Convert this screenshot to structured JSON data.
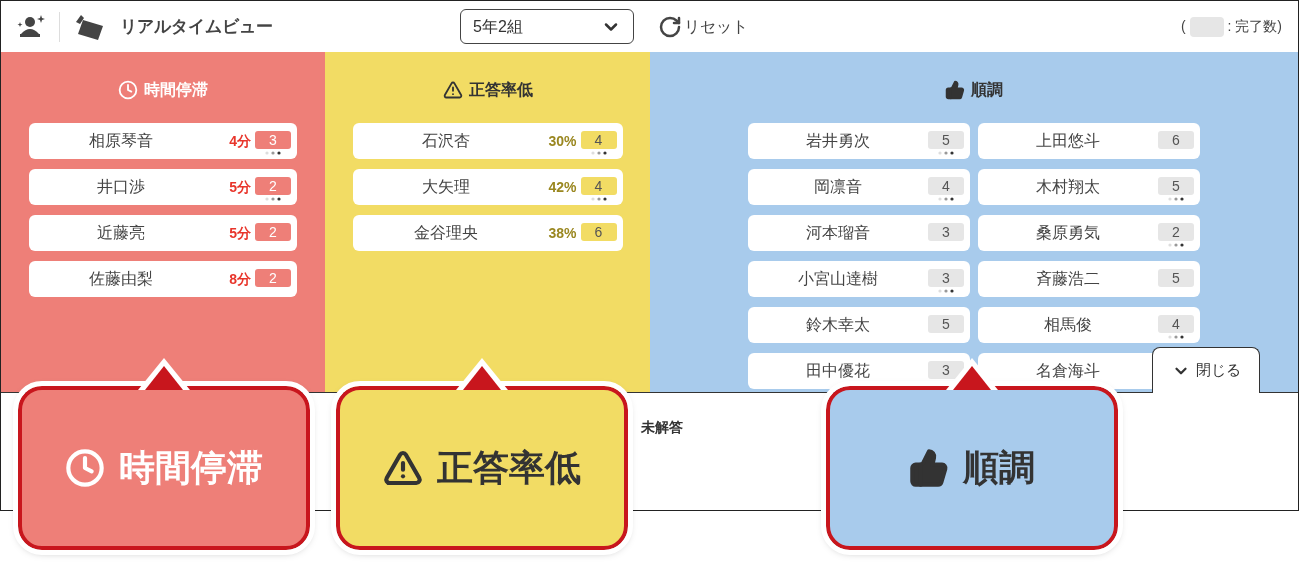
{
  "header": {
    "title": "リアルタイムビュー",
    "class_select": "5年2組",
    "reset": "リセット",
    "legend_open": "(",
    "legend_label": ": 完了数)"
  },
  "columns": [
    {
      "kind": "stalled",
      "title": "時間停滞",
      "students": [
        {
          "name": "相原琴音",
          "metric": "4分",
          "count": "3",
          "dots": true
        },
        {
          "name": "井口渉",
          "metric": "5分",
          "count": "2",
          "dots": true
        },
        {
          "name": "近藤亮",
          "metric": "5分",
          "count": "2",
          "dots": false
        },
        {
          "name": "佐藤由梨",
          "metric": "8分",
          "count": "2",
          "dots": false
        }
      ]
    },
    {
      "kind": "low_accuracy",
      "title": "正答率低",
      "students": [
        {
          "name": "石沢杏",
          "metric": "30%",
          "count": "4",
          "dots": true
        },
        {
          "name": "大矢理",
          "metric": "42%",
          "count": "4",
          "dots": true
        },
        {
          "name": "金谷理央",
          "metric": "38%",
          "count": "6",
          "dots": false
        }
      ]
    },
    {
      "kind": "on_track",
      "title": "順調",
      "students": [
        {
          "name": "岩井勇次",
          "count": "5",
          "dots": true
        },
        {
          "name": "上田悠斗",
          "count": "6",
          "dots": false
        },
        {
          "name": "岡凛音",
          "count": "4",
          "dots": true
        },
        {
          "name": "木村翔太",
          "count": "5",
          "dots": true
        },
        {
          "name": "河本瑠音",
          "count": "3",
          "dots": false
        },
        {
          "name": "桑原勇気",
          "count": "2",
          "dots": true
        },
        {
          "name": "小宮山達樹",
          "count": "3",
          "dots": true
        },
        {
          "name": "斉藤浩二",
          "count": "5",
          "dots": false
        },
        {
          "name": "鈴木幸太",
          "count": "5",
          "dots": false
        },
        {
          "name": "相馬俊",
          "count": "4",
          "dots": true
        },
        {
          "name": "田中優花",
          "count": "3"
        },
        {
          "name": "名倉海斗"
        }
      ]
    }
  ],
  "close_tab": "閉じる",
  "unanswered_label": "未解答",
  "callouts": [
    {
      "kind": "stalled",
      "label": "時間停滞"
    },
    {
      "kind": "low_accuracy",
      "label": "正答率低"
    },
    {
      "kind": "on_track",
      "label": "順調"
    }
  ]
}
